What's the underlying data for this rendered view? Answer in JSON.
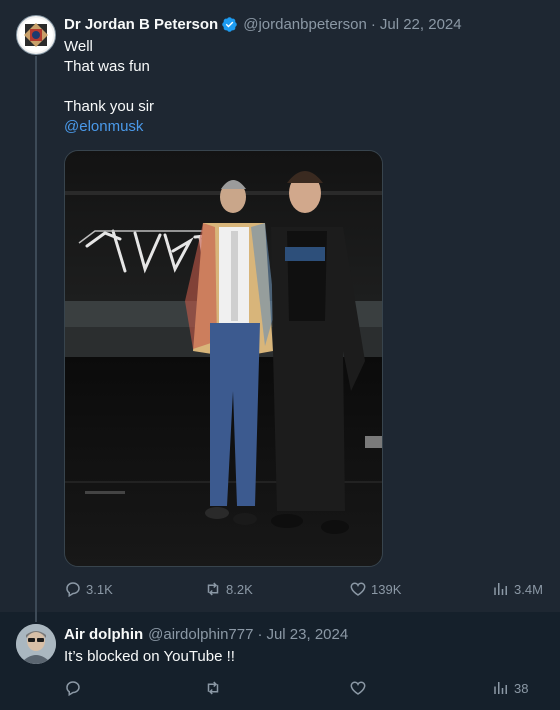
{
  "tweet": {
    "author_name": "Dr Jordan B Peterson",
    "handle": "@jordanbpeterson",
    "separator": "·",
    "date": "Jul 22, 2024",
    "lines": [
      "Well",
      "That was fun",
      "Thank you sir"
    ],
    "mention": "@elonmusk",
    "image_text": "CYBER",
    "stats": {
      "replies": "3.1K",
      "reposts": "8.2K",
      "likes": "139K",
      "views": "3.4M"
    }
  },
  "reply": {
    "author_name": "Air dolphin",
    "handle": "@airdolphin777",
    "separator": "·",
    "date": "Jul 23, 2024",
    "text": "It’s blocked on YouTube !!",
    "stats": {
      "views": "38"
    }
  },
  "colors": {
    "background": "#15202b",
    "highlight_bg": "#1e2732",
    "link": "#4a99e9",
    "muted": "#8b98a5",
    "verified": "#1d9bf0"
  }
}
